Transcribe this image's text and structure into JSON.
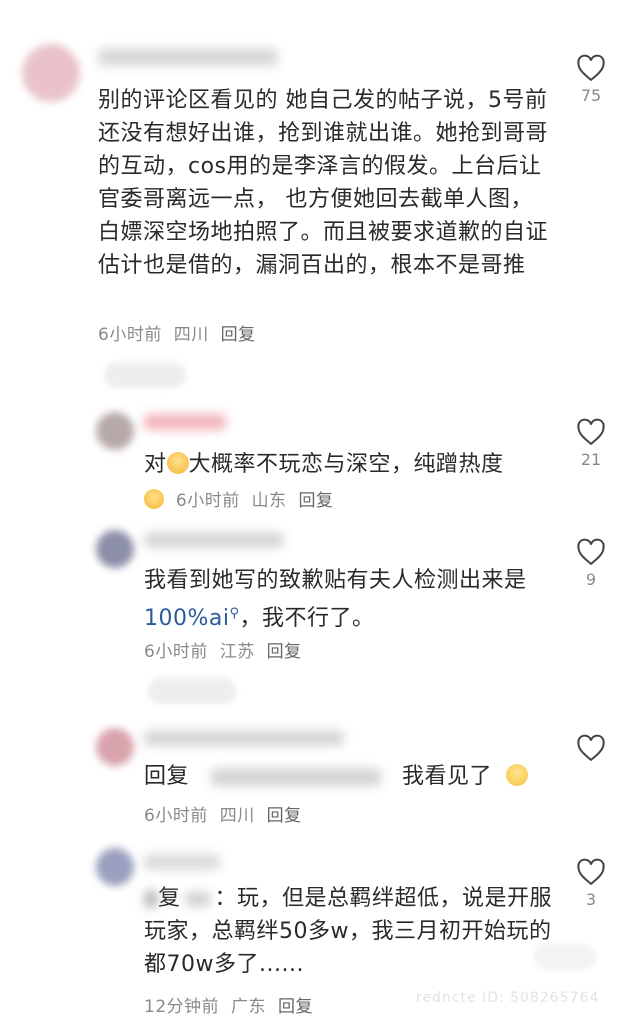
{
  "comments": [
    {
      "text": "别的评论区看见的 她自己发的帖子说，5号前还没有想好出谁，抢到谁就出谁。她抢到哥哥的互动，cos用的是李泽言的假发。上台后让官委哥离远一点， 也方便她回去截单人图，白嫖深空场地拍照了。而且被要求道歉的自证估计也是借的，漏洞百出的，根本不是哥推",
      "time": "6小时前",
      "location": "四川",
      "reply": "回复",
      "likes": "75"
    },
    {
      "text_prefix": "对",
      "text": "大概率不玩恋与深空，纯蹭热度",
      "time": "6小时前",
      "location": "山东",
      "reply": "回复",
      "likes": "21"
    },
    {
      "text": "我看到她写的致歉贴有夫人检测出来是",
      "link": "100%ai",
      "text_suffix": "，我不行了。",
      "time": "6小时前",
      "location": "江苏",
      "reply": "回复",
      "likes": "9"
    },
    {
      "text_prefix": "回复",
      "text": "我看见了",
      "time": "6小时前",
      "location": "四川",
      "reply": "回复",
      "likes": ""
    },
    {
      "text_prefix": "复",
      "text": "：玩，但是总羁绊超低，说是开服玩家，总羁绊50多w，我三月初开始玩的都70w多了......",
      "time": "12分钟前",
      "location": "广东",
      "reply": "回复",
      "likes": "3"
    }
  ],
  "watermark": "redncte ID: 508265764",
  "colors": {
    "link": "#2b5b9a",
    "meta": "#8a8a8a",
    "text": "#2a2a2a"
  },
  "icons": [
    "heart-icon",
    "crying-emoji-icon",
    "expressionless-emoji-icon",
    "search-icon"
  ]
}
